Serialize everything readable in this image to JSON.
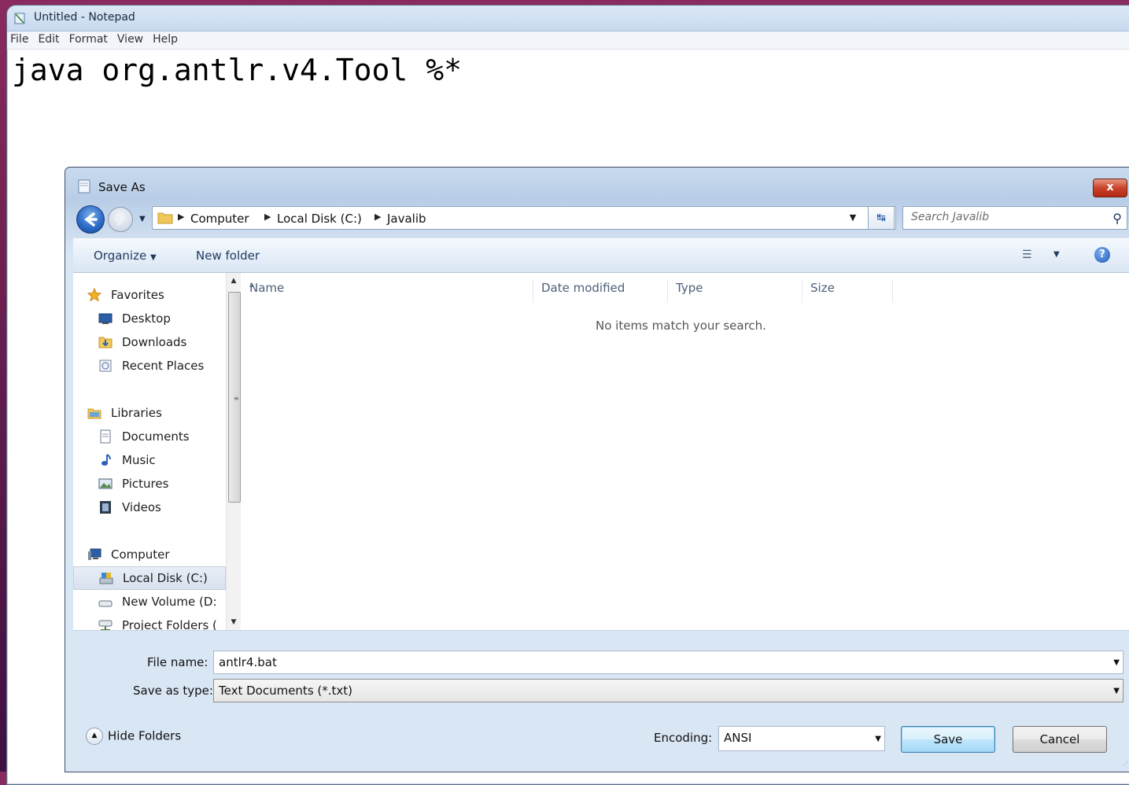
{
  "notepad": {
    "title": "Untitled - Notepad",
    "menu": [
      "File",
      "Edit",
      "Format",
      "View",
      "Help"
    ],
    "content": "java org.antlr.v4.Tool %*"
  },
  "dialog": {
    "title": "Save As",
    "close_label": "x",
    "breadcrumb": [
      "Computer",
      "Local Disk (C:)",
      "Javalib"
    ],
    "search_placeholder": "Search Javalib",
    "toolbar": {
      "organize": "Organize",
      "new_folder": "New folder",
      "help": "?"
    },
    "nav": {
      "favorites": "Favorites",
      "desktop": "Desktop",
      "downloads": "Downloads",
      "recent_places": "Recent Places",
      "libraries": "Libraries",
      "documents": "Documents",
      "music": "Music",
      "pictures": "Pictures",
      "videos": "Videos",
      "computer": "Computer",
      "local_disk": "Local Disk (C:)",
      "new_volume": "New Volume (D:",
      "project_folders": "Project Folders ("
    },
    "columns": [
      "Name",
      "Date modified",
      "Type",
      "Size"
    ],
    "empty_message": "No items match your search.",
    "file_name_label": "File name:",
    "file_name_value": "antlr4.bat",
    "save_type_label": "Save as type:",
    "save_type_value": "Text Documents (*.txt)",
    "hide_folders": "Hide Folders",
    "encoding_label": "Encoding:",
    "encoding_value": "ANSI",
    "save_button": "Save",
    "cancel_button": "Cancel"
  },
  "colors": {
    "accent": "#2b6cc7",
    "close_button": "#c9432a",
    "background": "#6a1f4f"
  }
}
